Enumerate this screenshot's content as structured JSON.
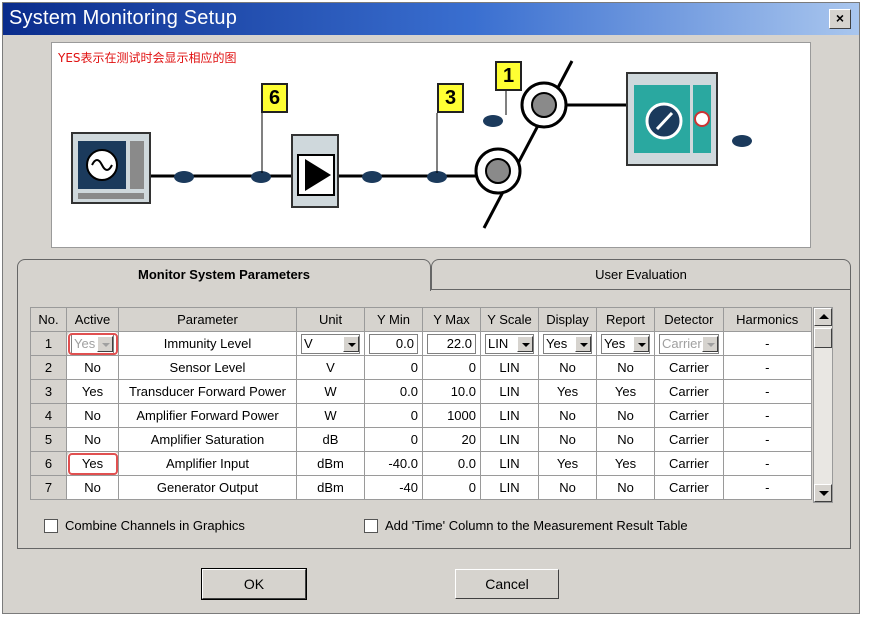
{
  "window": {
    "title": "System Monitoring Setup",
    "close_label": "×"
  },
  "diagram": {
    "note": "YES表示在测试时会显示相应的图",
    "badges": [
      "6",
      "3",
      "1"
    ]
  },
  "tabs": [
    {
      "label": "Monitor System Parameters",
      "active": true
    },
    {
      "label": "User Evaluation",
      "active": false
    }
  ],
  "table": {
    "columns": [
      "No.",
      "Active",
      "Parameter",
      "Unit",
      "Y Min",
      "Y Max",
      "Y Scale",
      "Display",
      "Report",
      "Detector",
      "Harmonics"
    ],
    "rows": [
      {
        "no": "1",
        "active": "Yes",
        "parameter": "Immunity Level",
        "unit": "V",
        "ymin": "0.0",
        "ymax": "22.0",
        "yscale": "LIN",
        "display": "Yes",
        "report": "Yes",
        "detector": "Carrier",
        "harmonics": "-"
      },
      {
        "no": "2",
        "active": "No",
        "parameter": "Sensor Level",
        "unit": "V",
        "ymin": "0",
        "ymax": "0",
        "yscale": "LIN",
        "display": "No",
        "report": "No",
        "detector": "Carrier",
        "harmonics": "-"
      },
      {
        "no": "3",
        "active": "Yes",
        "parameter": "Transducer Forward Power",
        "unit": "W",
        "ymin": "0.0",
        "ymax": "10.0",
        "yscale": "LIN",
        "display": "Yes",
        "report": "Yes",
        "detector": "Carrier",
        "harmonics": "-"
      },
      {
        "no": "4",
        "active": "No",
        "parameter": "Amplifier Forward Power",
        "unit": "W",
        "ymin": "0",
        "ymax": "1000",
        "yscale": "LIN",
        "display": "No",
        "report": "No",
        "detector": "Carrier",
        "harmonics": "-"
      },
      {
        "no": "5",
        "active": "No",
        "parameter": "Amplifier Saturation",
        "unit": "dB",
        "ymin": "0",
        "ymax": "20",
        "yscale": "LIN",
        "display": "No",
        "report": "No",
        "detector": "Carrier",
        "harmonics": "-"
      },
      {
        "no": "6",
        "active": "Yes",
        "parameter": "Amplifier Input",
        "unit": "dBm",
        "ymin": "-40.0",
        "ymax": "0.0",
        "yscale": "LIN",
        "display": "Yes",
        "report": "Yes",
        "detector": "Carrier",
        "harmonics": "-"
      },
      {
        "no": "7",
        "active": "No",
        "parameter": "Generator Output",
        "unit": "dBm",
        "ymin": "-40",
        "ymax": "0",
        "yscale": "LIN",
        "display": "No",
        "report": "No",
        "detector": "Carrier",
        "harmonics": "-"
      }
    ]
  },
  "options": {
    "combine_channels": "Combine Channels in Graphics",
    "add_time_column": "Add 'Time' Column to the Measurement Result Table"
  },
  "buttons": {
    "ok": "OK",
    "cancel": "Cancel"
  },
  "colors": {
    "title_start": "#0a2c8c",
    "title_end": "#a9c6ee",
    "dialog_bg": "#d6d3ce",
    "badge": "#ffff33",
    "note": "#e01010",
    "device_teal": "#2aa8a0"
  }
}
